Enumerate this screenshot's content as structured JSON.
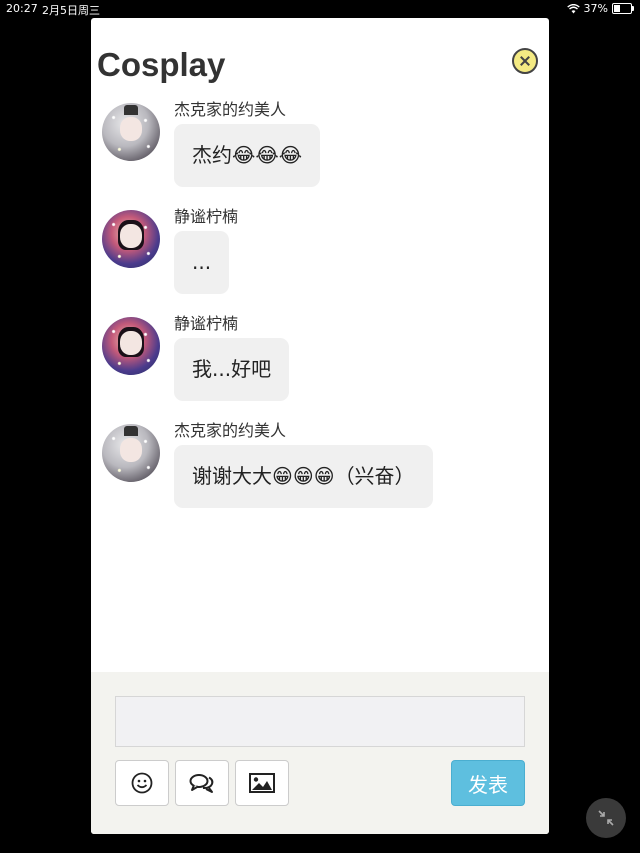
{
  "status_bar": {
    "time": "20:27",
    "date": "2月5日周三",
    "battery": "37%",
    "battery_level": 0.37
  },
  "title": "Cosplay",
  "messages": [
    {
      "username": "杰克家的约美人",
      "avatar": "gray",
      "text": "杰约",
      "emoji": "😂😂😂"
    },
    {
      "username": "静谧柠楠",
      "avatar": "color",
      "text": "...",
      "emoji": ""
    },
    {
      "username": "静谧柠楠",
      "avatar": "color",
      "text": "我...好吧",
      "emoji": ""
    },
    {
      "username": "杰克家的约美人",
      "avatar": "gray",
      "text": "谢谢大大",
      "emoji": "😁😁😁",
      "suffix": "（兴奋）"
    }
  ],
  "composer": {
    "input_value": "",
    "send_label": "发表"
  },
  "icons": {
    "close": "close-icon",
    "emoji": "smiley-icon",
    "quote": "chat-bubbles-icon",
    "image": "image-icon",
    "collapse": "collapse-arrows-icon"
  },
  "colors": {
    "send": "#5ebfdf",
    "close": "#f4ea83",
    "bubble": "#f0f0f0"
  }
}
